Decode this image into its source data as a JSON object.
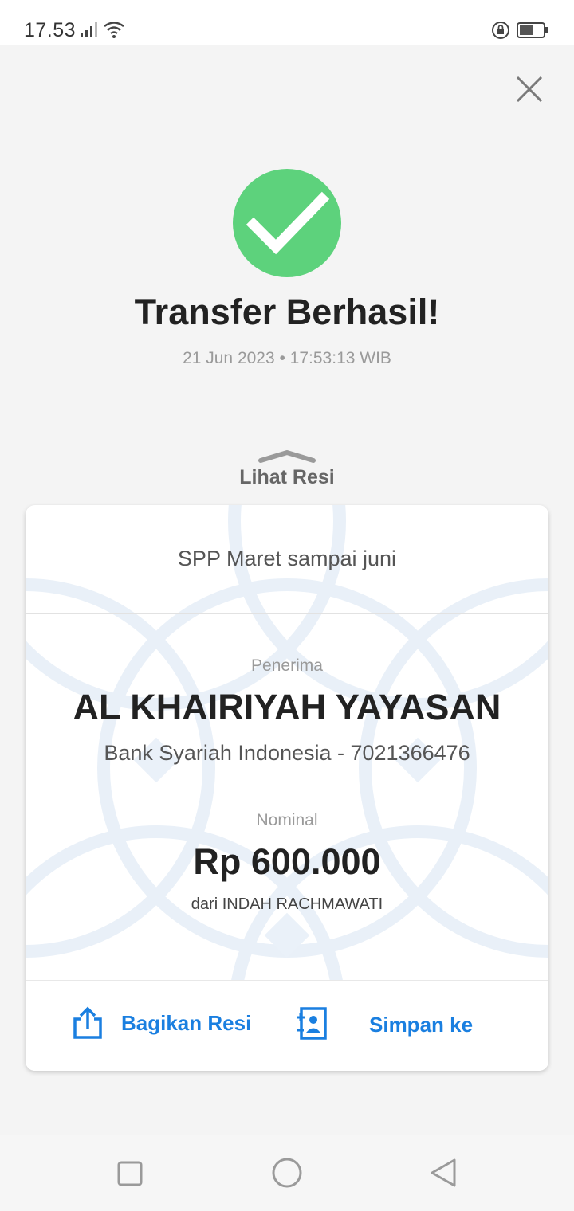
{
  "status_bar": {
    "time": "17.53"
  },
  "header": {
    "title": "Transfer Berhasil!",
    "datetime": "21 Jun 2023 • 17:53:13 WIB"
  },
  "receipt_toggle": {
    "label": "Lihat Resi"
  },
  "receipt": {
    "note": "SPP Maret sampai juni",
    "recipient_label": "Penerima",
    "recipient_name": "AL KHAIRIYAH YAYASAN",
    "recipient_account": "Bank Syariah Indonesia - 7021366476",
    "amount_label": "Nominal",
    "amount": "Rp 600.000",
    "sender": "dari INDAH RACHMAWATI"
  },
  "actions": {
    "share_label": "Bagikan Resi",
    "save_label": "Simpan ke"
  },
  "colors": {
    "success": "#5dd27c",
    "accent": "#1a7fe0"
  },
  "icons": {
    "close": "close-icon",
    "success": "checkmark-icon",
    "share": "share-icon",
    "save": "contact-save-icon",
    "nav_recent": "square-icon",
    "nav_home": "circle-icon",
    "nav_back": "triangle-back-icon"
  }
}
